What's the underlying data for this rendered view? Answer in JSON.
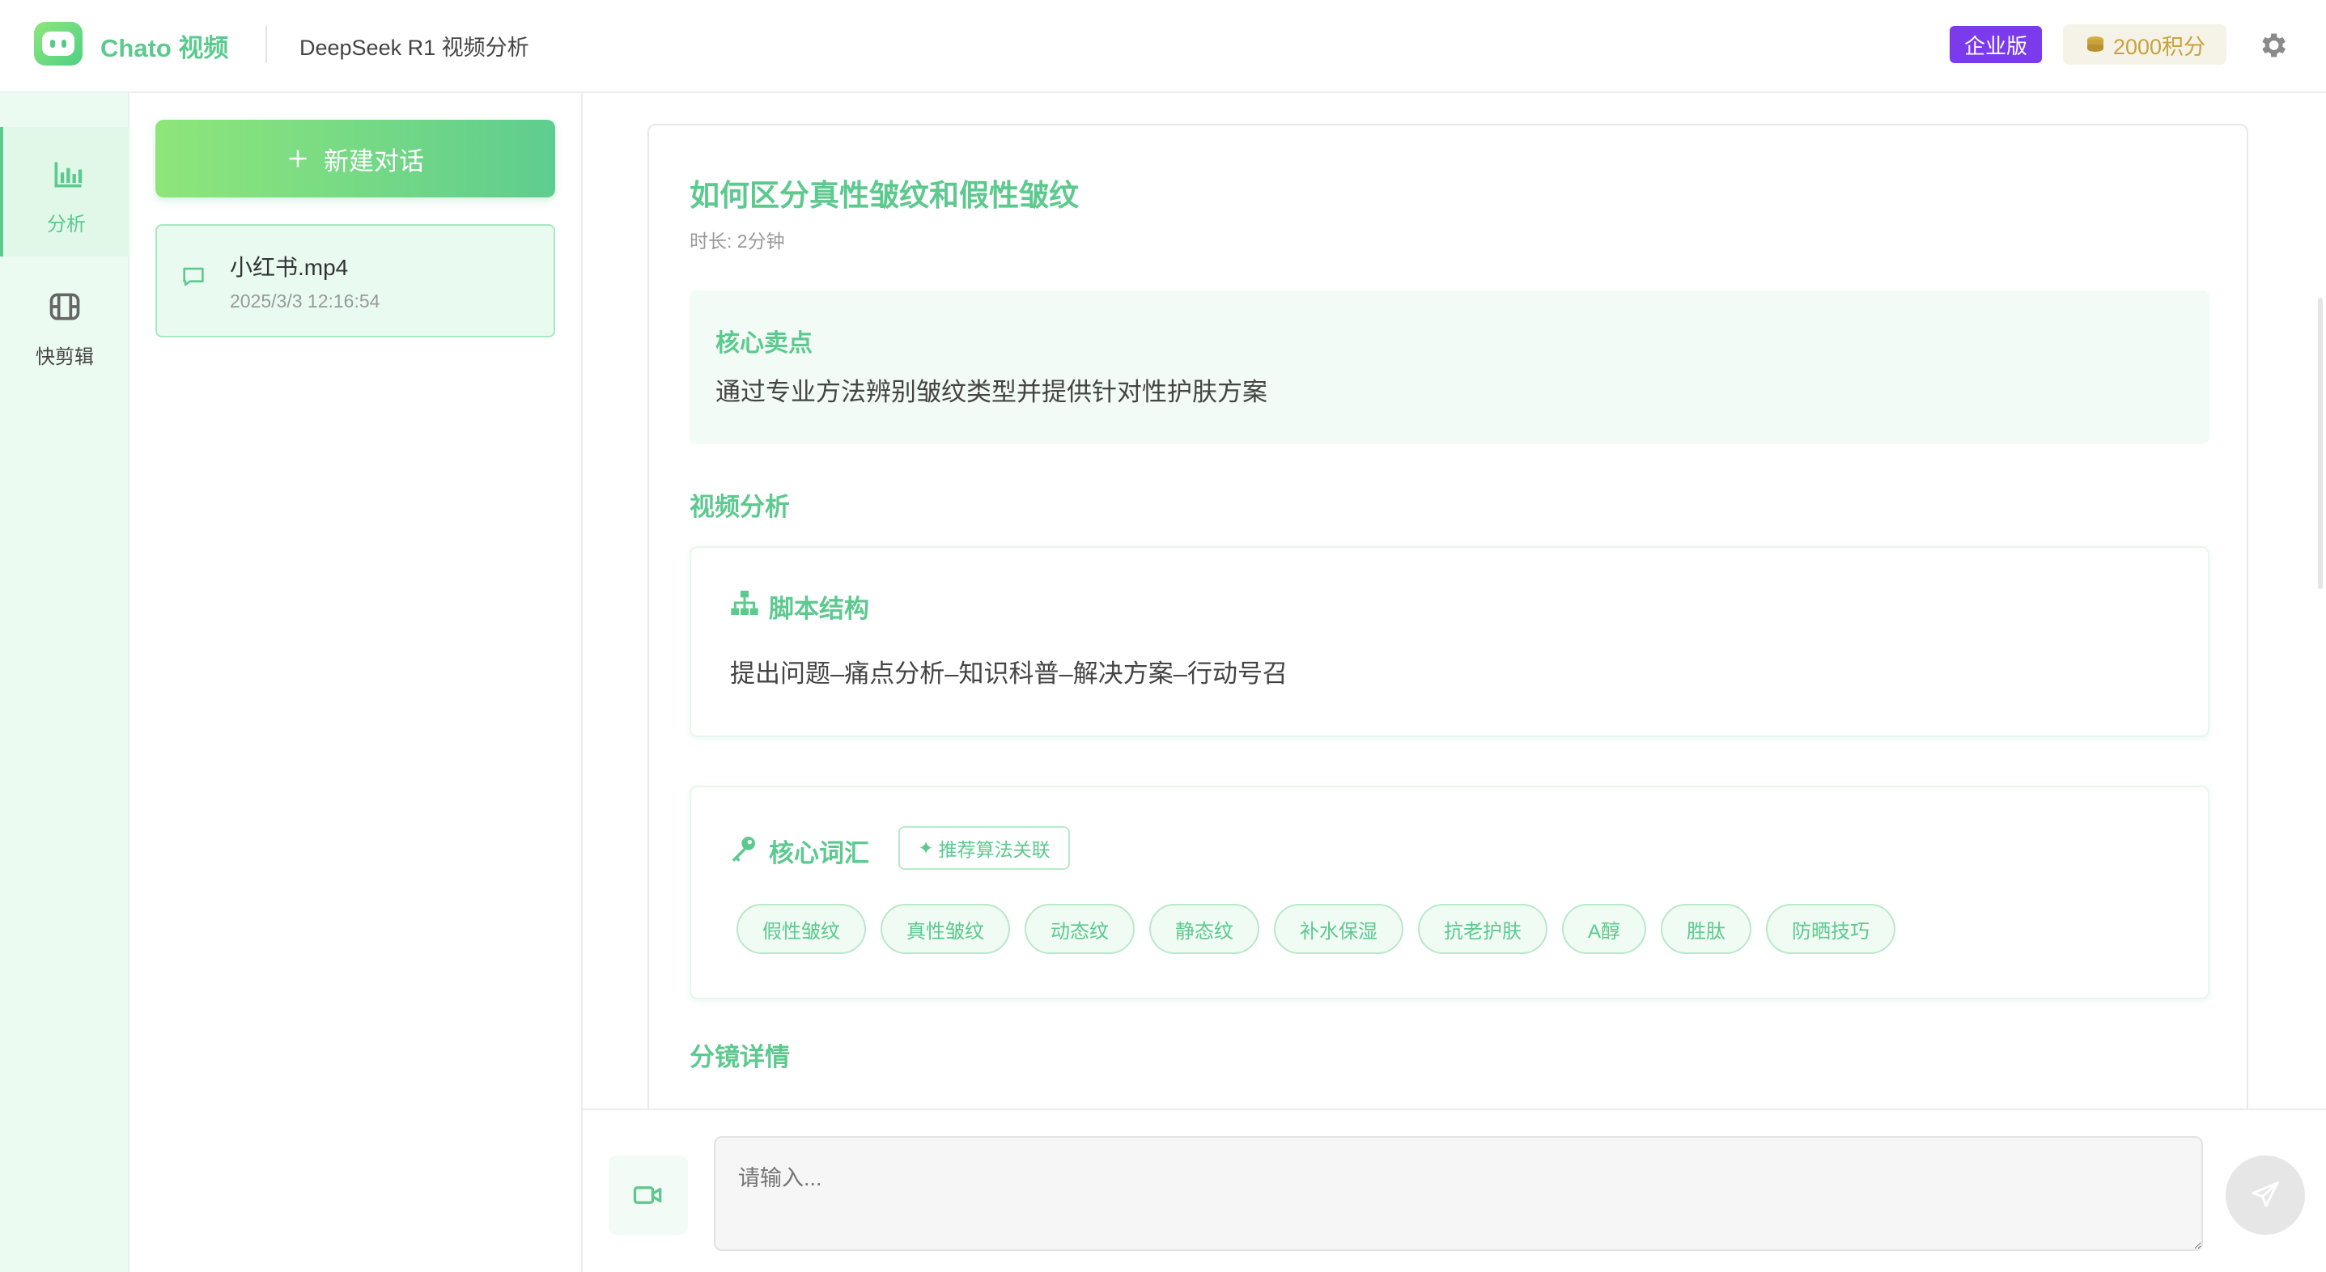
{
  "header": {
    "brand": "Chato 视频",
    "subtitle": "DeepSeek R1 视频分析",
    "edition_badge": "企业版",
    "points": "2000积分"
  },
  "rail": {
    "items": [
      {
        "label": "分析",
        "icon": "bar-chart-icon",
        "active": true
      },
      {
        "label": "快剪辑",
        "icon": "film-icon",
        "active": false
      }
    ]
  },
  "conversations": {
    "new_button": "新建对话",
    "items": [
      {
        "title": "小红书.mp4",
        "time": "2025/3/3 12:16:54"
      }
    ]
  },
  "analysis": {
    "title": "如何区分真性皱纹和假性皱纹",
    "duration": "时长: 2分钟",
    "selling_point_header": "核心卖点",
    "selling_point_text": "通过专业方法辨别皱纹类型并提供针对性护肤方案",
    "video_analysis_header": "视频分析",
    "script_header": "脚本结构",
    "script_text": "提出问题–痛点分析–知识科普–解决方案–行动号召",
    "keywords_header": "核心词汇",
    "algo_tag": "推荐算法关联",
    "keywords": [
      "假性皱纹",
      "真性皱纹",
      "动态纹",
      "静态纹",
      "补水保湿",
      "抗老护肤",
      "A醇",
      "胜肽",
      "防晒技巧"
    ],
    "storyboard_header": "分镜详情"
  },
  "composer": {
    "placeholder": "请输入..."
  },
  "colors": {
    "accent": "#5cc98e",
    "enterprise": "#7c3aed",
    "gold": "#c9a23b"
  }
}
